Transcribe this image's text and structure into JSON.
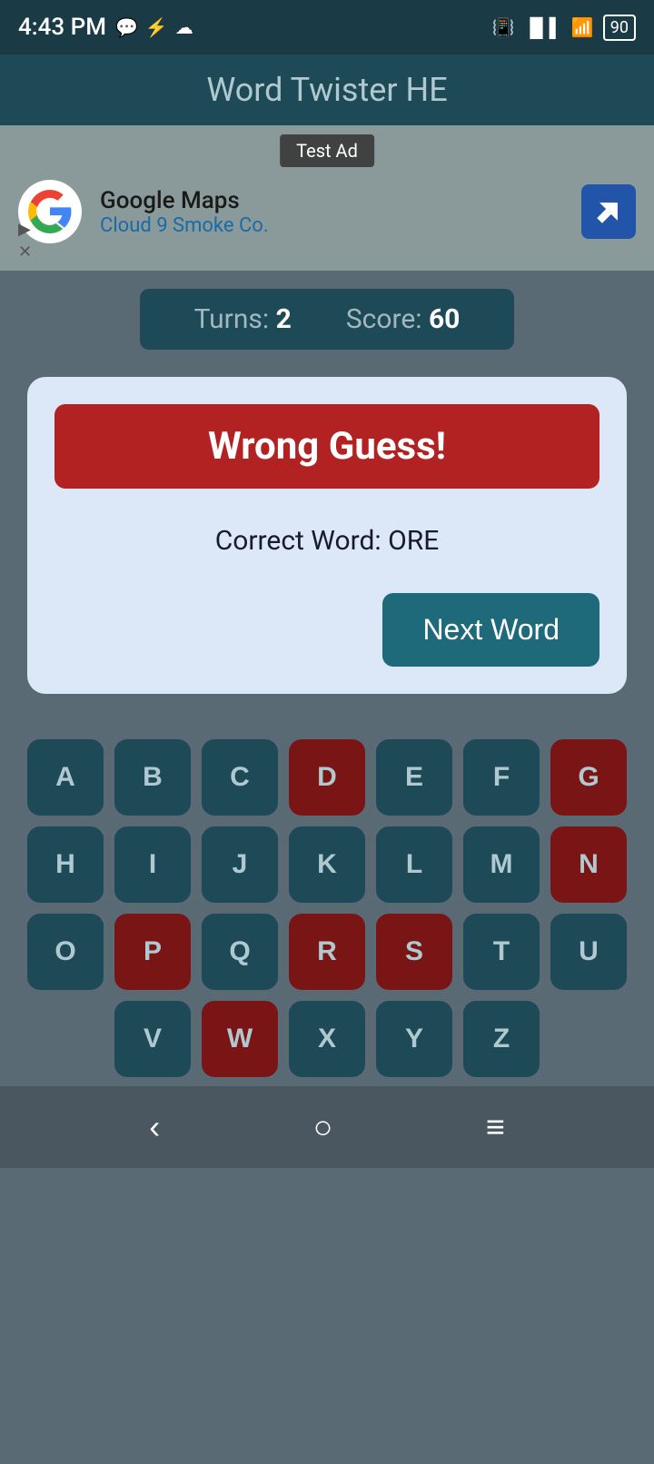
{
  "statusBar": {
    "time": "4:43 PM",
    "battery": "90"
  },
  "titleBar": {
    "title": "Word Twister HE"
  },
  "ad": {
    "label": "Test Ad",
    "company": "Google Maps",
    "subtitle": "Cloud 9 Smoke Co."
  },
  "scoreBar": {
    "turnsLabel": "Turns:",
    "turnsValue": "2",
    "scoreLabel": "Score:",
    "scoreValue": "60"
  },
  "dialog": {
    "wrongGuessLabel": "Wrong Guess!",
    "correctWordLabel": "Correct Word: ORE",
    "nextWordButton": "Next Word"
  },
  "keyboard": {
    "rows": [
      [
        "A",
        "B",
        "C",
        "D",
        "E",
        "F",
        "G"
      ],
      [
        "H",
        "I",
        "J",
        "K",
        "L",
        "M",
        "N"
      ],
      [
        "O",
        "P",
        "Q",
        "R",
        "S",
        "T",
        "U"
      ],
      [
        "V",
        "W",
        "X",
        "Y",
        "Z"
      ]
    ],
    "usedKeys": [
      "D",
      "G",
      "N",
      "P",
      "R",
      "S",
      "W"
    ]
  },
  "navBar": {
    "backIcon": "‹",
    "homeIcon": "○",
    "menuIcon": "≡"
  }
}
